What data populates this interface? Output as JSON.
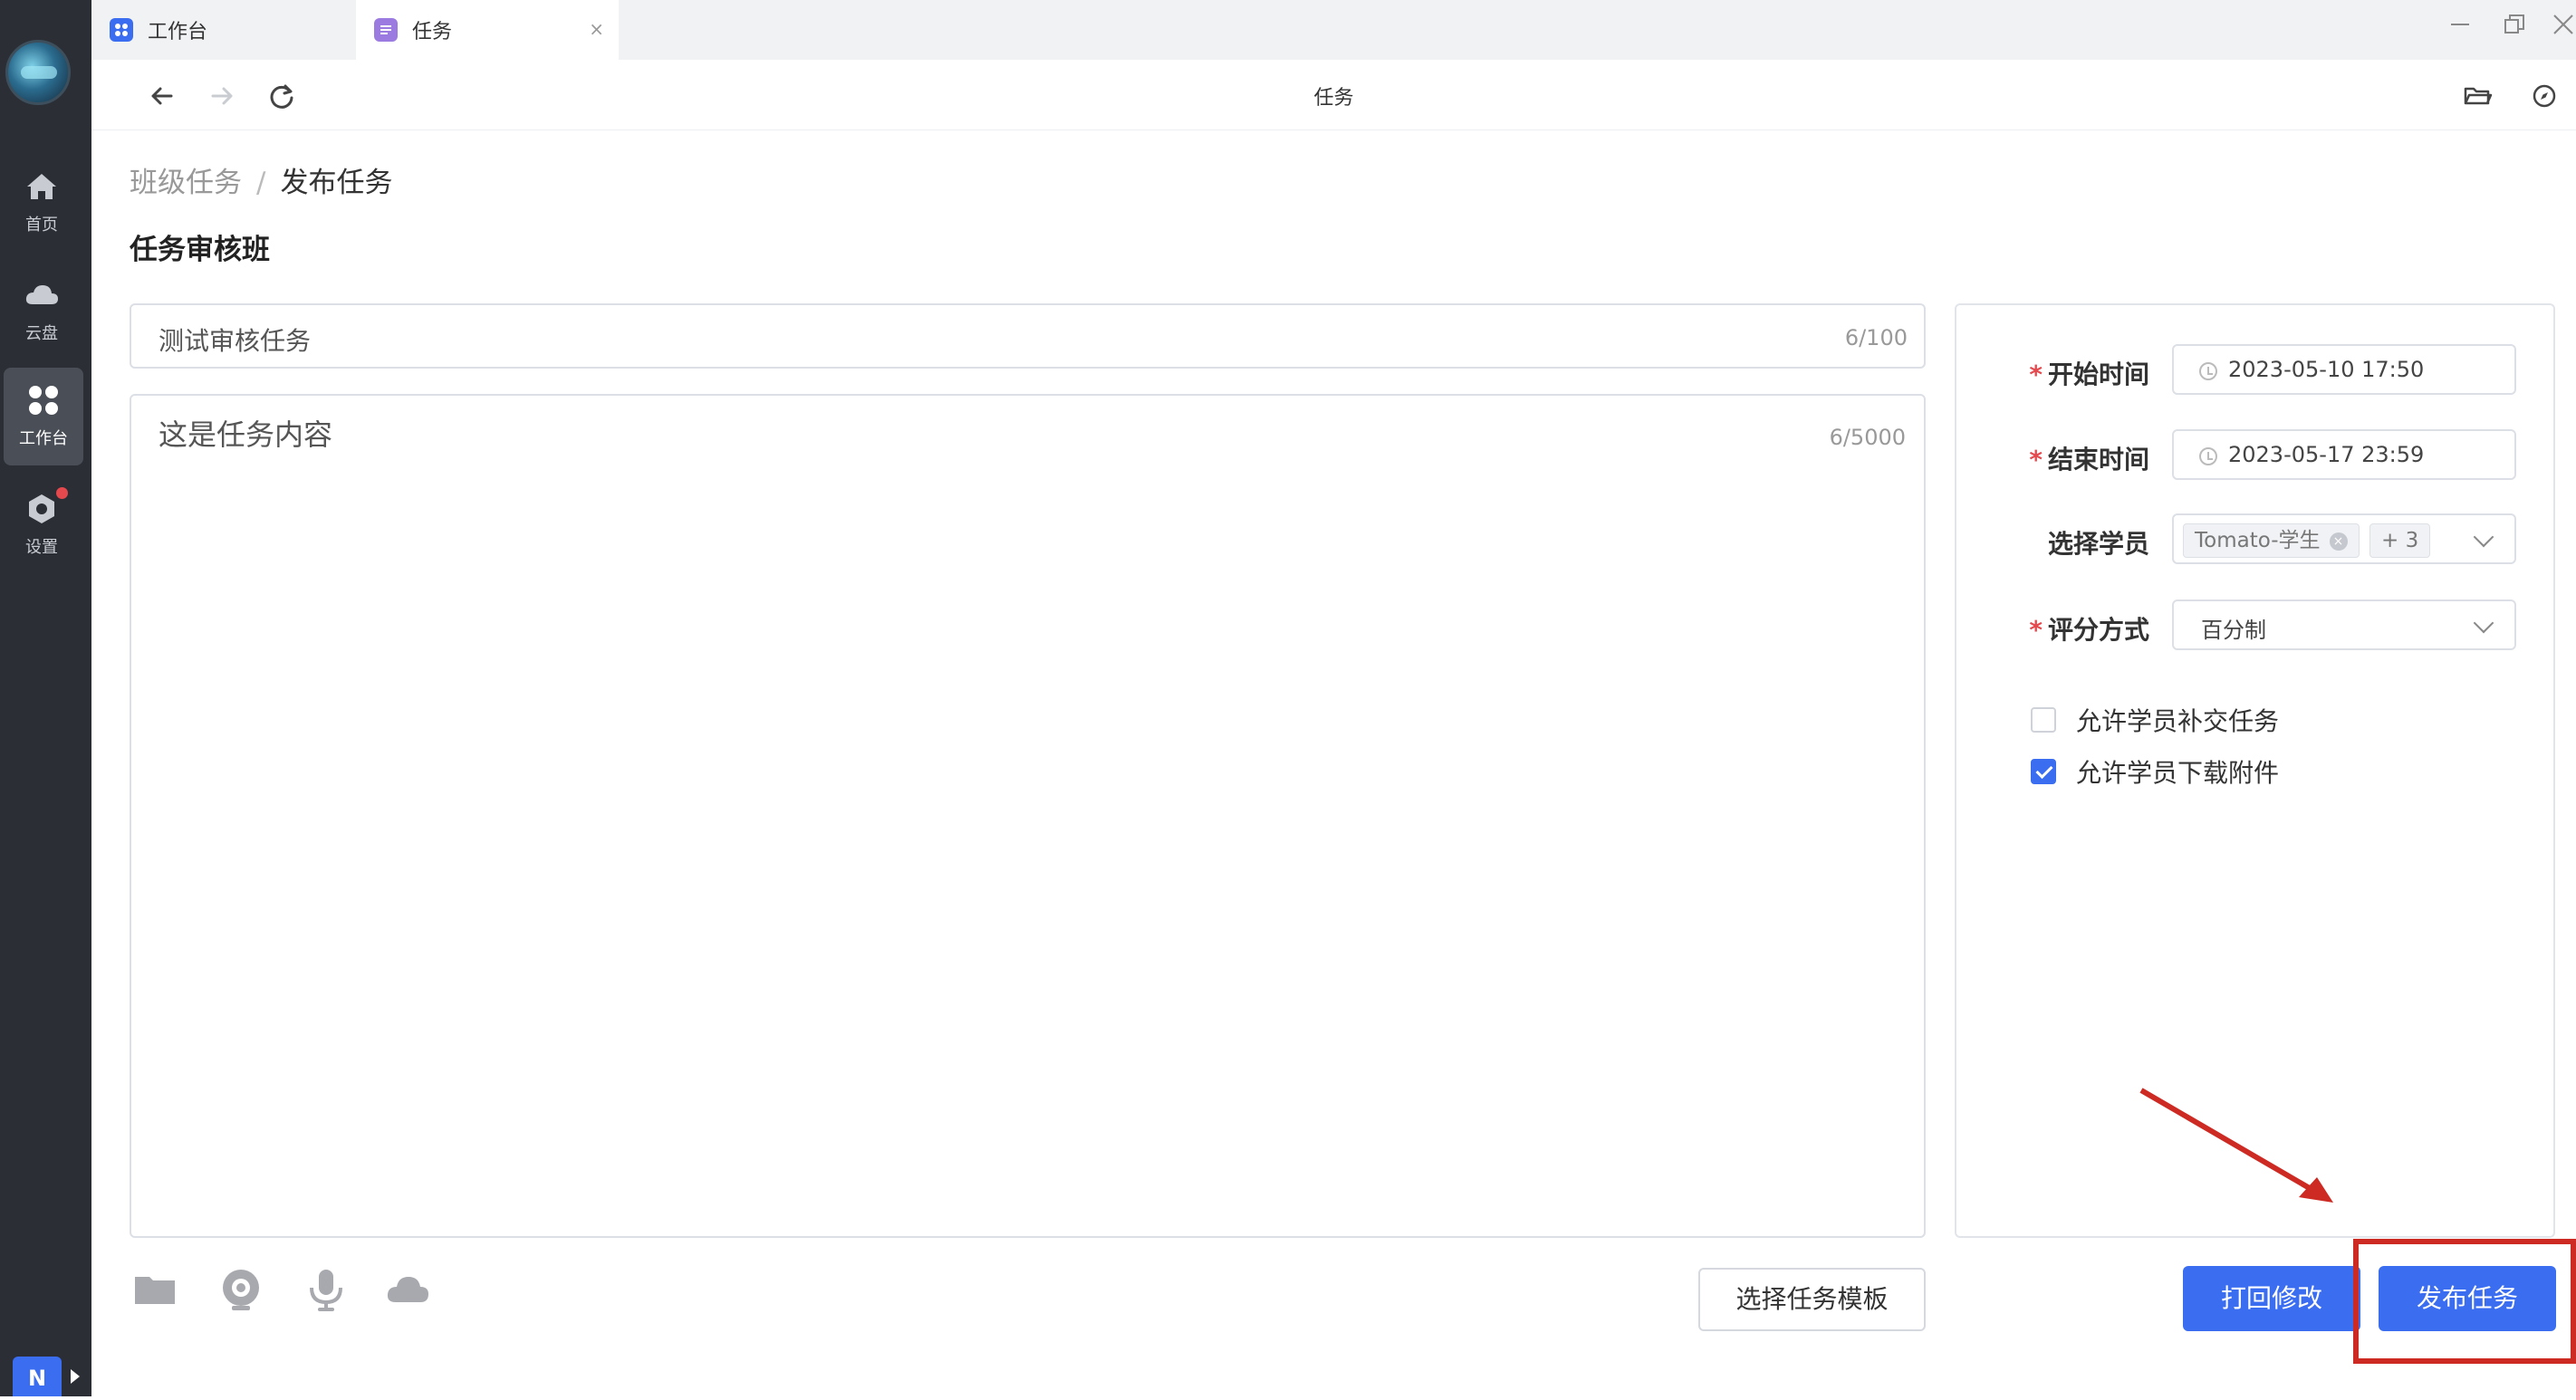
{
  "rail": {
    "items": [
      {
        "label": "首页",
        "icon": "home-icon"
      },
      {
        "label": "云盘",
        "icon": "cloud-icon"
      },
      {
        "label": "工作台",
        "icon": "grid-icon",
        "active": true
      },
      {
        "label": "设置",
        "icon": "settings-icon",
        "notification": true
      }
    ],
    "badge": "N"
  },
  "tabs": [
    {
      "label": "工作台",
      "icon": "grid-icon",
      "active": false
    },
    {
      "label": "任务",
      "icon": "task-icon",
      "active": true
    }
  ],
  "toolbar": {
    "title": "任务"
  },
  "breadcrumb": {
    "parent": "班级任务",
    "separator": "/",
    "current": "发布任务"
  },
  "page": {
    "title": "任务审核班"
  },
  "task": {
    "title_value": "测试审核任务",
    "title_counter": "6/100",
    "content_value": "这是任务内容",
    "content_counter": "6/5000"
  },
  "form": {
    "start_label": "开始时间",
    "start_value": "2023-05-10 17:50",
    "end_label": "结束时间",
    "end_value": "2023-05-17 23:59",
    "students_label": "选择学员",
    "student_tag": "Tomato-学生",
    "student_more": "+ 3",
    "grading_label": "评分方式",
    "grading_value": "百分制",
    "required_mark": "*",
    "allow_late_label": "允许学员补交任务",
    "allow_late_checked": false,
    "allow_download_label": "允许学员下载附件",
    "allow_download_checked": true
  },
  "buttons": {
    "template": "选择任务模板",
    "reject": "打回修改",
    "publish": "发布任务"
  },
  "colors": {
    "primary": "#3a6df0",
    "rail": "#2b2e34",
    "annotation": "#cc2a22"
  }
}
